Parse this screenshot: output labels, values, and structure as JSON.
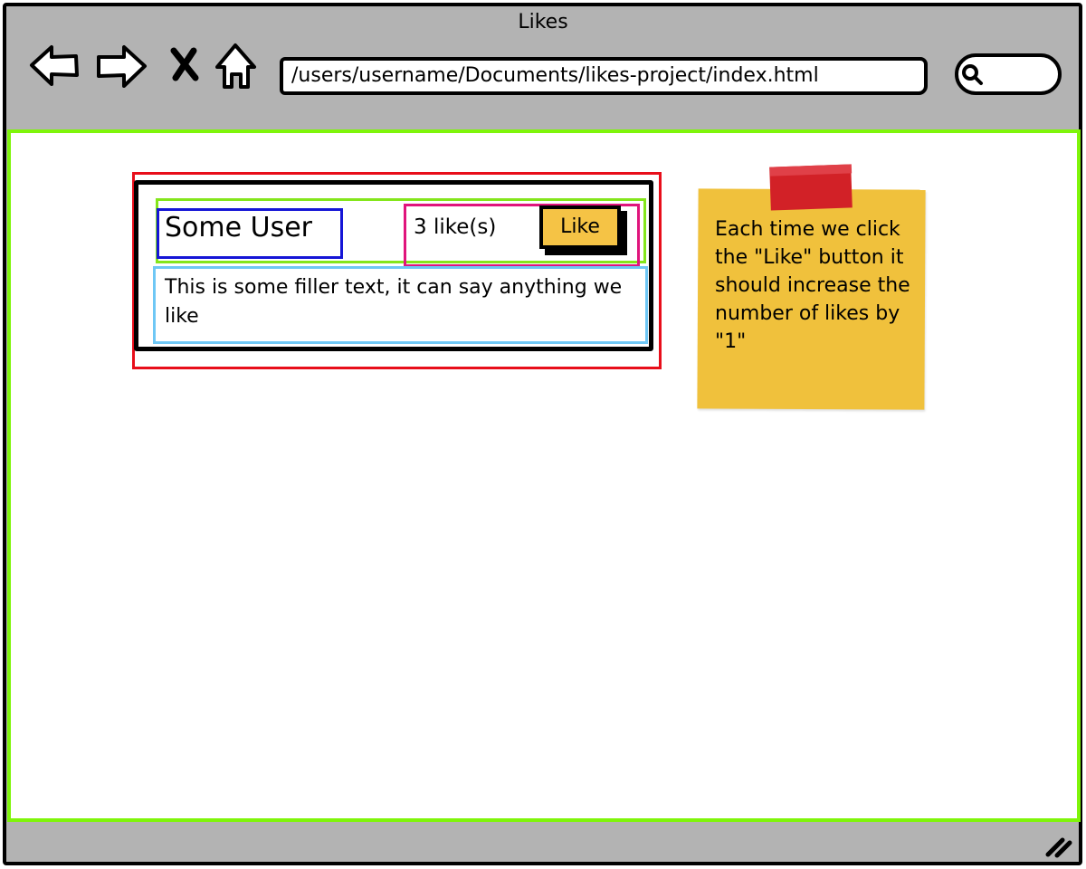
{
  "browser": {
    "title": "Likes",
    "url": "/users/username/Documents/likes-project/index.html"
  },
  "icons": {
    "back": "back-arrow-icon",
    "forward": "forward-arrow-icon",
    "stop": "close-icon",
    "home": "home-icon",
    "search": "search-icon",
    "resize": "resize-handle-icon"
  },
  "post": {
    "username": "Some User",
    "likes_text": "3 like(s)",
    "like_button_label": "Like",
    "body": "This is some filler text, it can say anything we like"
  },
  "note": {
    "text": "Each time we click the \"Like\" button it should increase the number of likes by \"1\""
  },
  "colors": {
    "frame": "#b3b3b3",
    "viewport_border": "#7ff50a",
    "card_outline": "#e80e1a",
    "header_outline": "#84e61b",
    "username_outline": "#1515d6",
    "likes_outline": "#e0147c",
    "body_outline": "#6ec7f5",
    "like_button": "#f5c345",
    "sticky_note": "#f0c13c",
    "tape": "#d22127"
  }
}
